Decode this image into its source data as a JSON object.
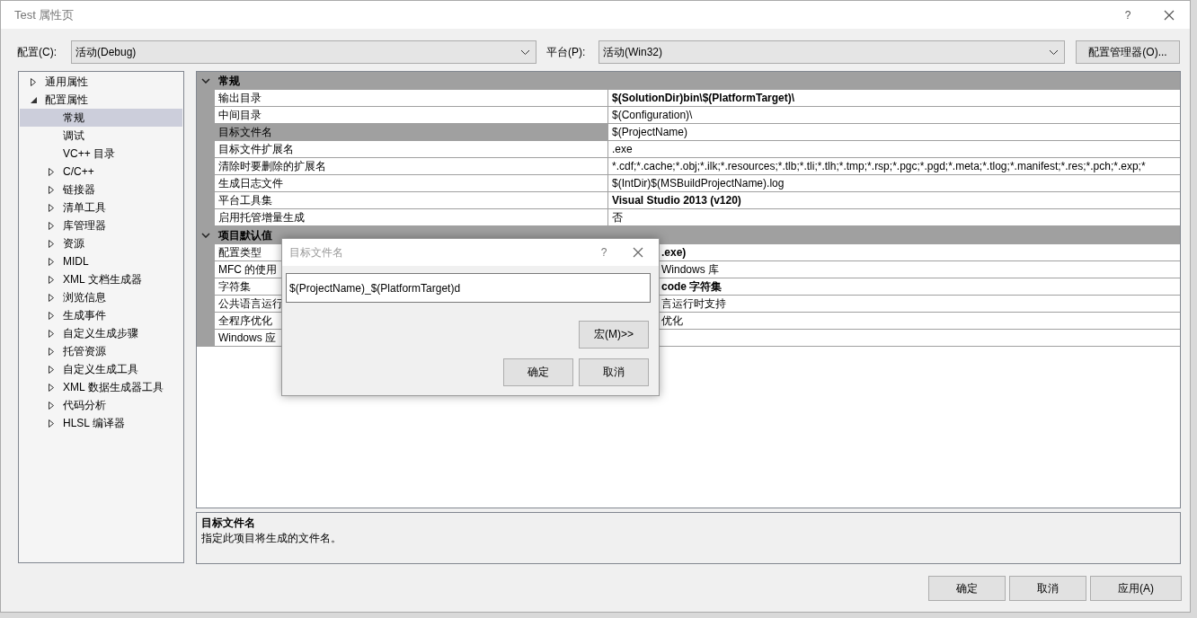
{
  "window": {
    "title": "Test 属性页",
    "help": "?"
  },
  "toolbar": {
    "config_label": "配置(C):",
    "config_value": "活动(Debug)",
    "platform_label": "平台(P):",
    "platform_value": "活动(Win32)",
    "manager_button": "配置管理器(O)..."
  },
  "tree": [
    {
      "label": "通用属性",
      "expanded": false,
      "selected": false
    },
    {
      "label": "配置属性",
      "expanded": true,
      "selected": false,
      "children": [
        {
          "label": "常规",
          "selected": true
        },
        {
          "label": "调试",
          "selected": false
        },
        {
          "label": "VC++ 目录",
          "selected": false
        },
        {
          "label": "C/C++",
          "expanded": false,
          "selected": false
        },
        {
          "label": "链接器",
          "expanded": false,
          "selected": false
        },
        {
          "label": "清单工具",
          "expanded": false,
          "selected": false
        },
        {
          "label": "库管理器",
          "expanded": false,
          "selected": false
        },
        {
          "label": "资源",
          "expanded": false,
          "selected": false
        },
        {
          "label": "MIDL",
          "expanded": false,
          "selected": false
        },
        {
          "label": "XML 文档生成器",
          "expanded": false,
          "selected": false
        },
        {
          "label": "浏览信息",
          "expanded": false,
          "selected": false
        },
        {
          "label": "生成事件",
          "expanded": false,
          "selected": false
        },
        {
          "label": "自定义生成步骤",
          "expanded": false,
          "selected": false
        },
        {
          "label": "托管资源",
          "expanded": false,
          "selected": false
        },
        {
          "label": "自定义生成工具",
          "expanded": false,
          "selected": false
        },
        {
          "label": "XML 数据生成器工具",
          "expanded": false,
          "selected": false
        },
        {
          "label": "代码分析",
          "expanded": false,
          "selected": false
        },
        {
          "label": "HLSL 编译器",
          "expanded": false,
          "selected": false
        }
      ]
    }
  ],
  "grid": {
    "groups": [
      {
        "title": "常规",
        "expanded": true,
        "rows": [
          {
            "label": "输出目录",
            "value": "$(SolutionDir)bin\\$(PlatformTarget)\\",
            "bold": true,
            "selected": false
          },
          {
            "label": "中间目录",
            "value": "$(Configuration)\\",
            "bold": false,
            "selected": false
          },
          {
            "label": "目标文件名",
            "value": "$(ProjectName)",
            "bold": false,
            "selected": true
          },
          {
            "label": "目标文件扩展名",
            "value": ".exe",
            "bold": false,
            "selected": false
          },
          {
            "label": "清除时要删除的扩展名",
            "value": "*.cdf;*.cache;*.obj;*.ilk;*.resources;*.tlb;*.tli;*.tlh;*.tmp;*.rsp;*.pgc;*.pgd;*.meta;*.tlog;*.manifest;*.res;*.pch;*.exp;*",
            "bold": false,
            "selected": false
          },
          {
            "label": "生成日志文件",
            "value": "$(IntDir)$(MSBuildProjectName).log",
            "bold": false,
            "selected": false
          },
          {
            "label": "平台工具集",
            "value": "Visual Studio 2013 (v120)",
            "bold": true,
            "selected": false
          },
          {
            "label": "启用托管增量生成",
            "value": "否",
            "bold": false,
            "selected": false
          }
        ]
      },
      {
        "title": "项目默认值",
        "expanded": true,
        "rows": [
          {
            "label": "配置类型",
            "value": ".exe)",
            "bold": true,
            "selected": false
          },
          {
            "label": "MFC 的使用",
            "value": "Windows 库",
            "bold": false,
            "selected": false
          },
          {
            "label": "字符集",
            "value": "code 字符集",
            "bold": true,
            "selected": false
          },
          {
            "label": "公共语言运行",
            "value": "言运行时支持",
            "bold": false,
            "selected": false
          },
          {
            "label": "全程序优化",
            "value": "优化",
            "bold": false,
            "selected": false
          },
          {
            "label": "Windows 应",
            "bold": false,
            "selected": false
          }
        ]
      }
    ]
  },
  "description": {
    "title": "目标文件名",
    "text": "指定此项目将生成的文件名。"
  },
  "buttons": [
    "确定",
    "取消",
    "应用(A)"
  ],
  "dialog": {
    "title": "目标文件名",
    "help": "?",
    "value": "$(ProjectName)_$(PlatformTarget)d",
    "macro_button": "宏(M)>>",
    "buttons": [
      "确定",
      "取消"
    ]
  }
}
